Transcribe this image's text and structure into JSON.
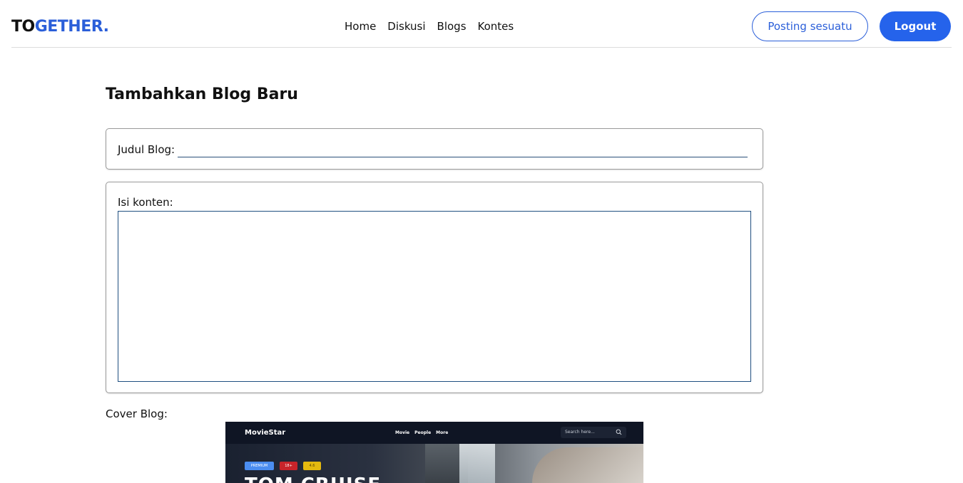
{
  "header": {
    "logo_part1": "TO",
    "logo_part2": "GETHER.",
    "nav": [
      "Home",
      "Diskusi",
      "Blogs",
      "Kontes"
    ],
    "post_button": "Posting sesuatu",
    "logout_button": "Logout"
  },
  "page": {
    "title": "Tambahkan Blog Baru"
  },
  "form": {
    "title_label": "Judul Blog:",
    "title_value": "",
    "content_label": "Isi konten:",
    "content_value": "",
    "cover_label": "Cover Blog:"
  },
  "cover_preview": {
    "brand": "MovieStar",
    "menu": [
      "Movie",
      "People",
      "More"
    ],
    "search_placeholder": "Search here...",
    "badges": [
      "PREMIUM",
      "18+",
      "4.6"
    ],
    "headline": "TOM CRUISE"
  },
  "colors": {
    "accent": "#2563eb",
    "logo_blue": "#2b5fd9"
  }
}
